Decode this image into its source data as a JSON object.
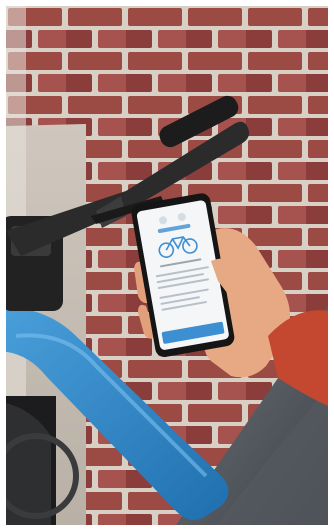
{
  "photo": {
    "subject": "photo-bike-phone-app",
    "colors": {
      "brick": "#9b4a44",
      "mortar": "#d8cfc5",
      "frame_blue": "#2f86c8",
      "handlebar": "#2b2b2b",
      "skin": "#e7a983",
      "sleeve": "#c4482f",
      "screen": "#f4f6f8",
      "app_accent": "#3d8fd1"
    }
  }
}
